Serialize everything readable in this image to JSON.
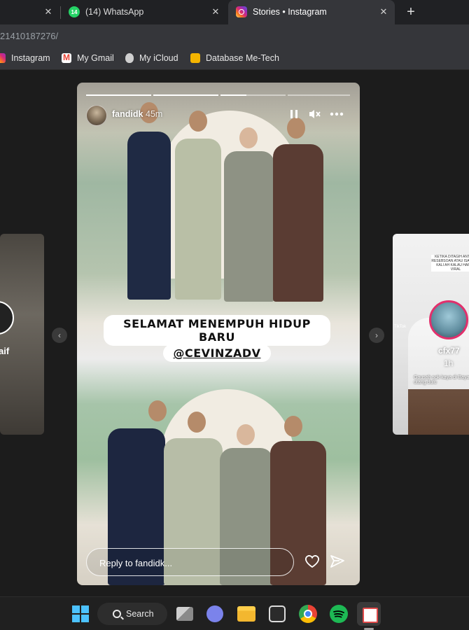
{
  "browser": {
    "tabs": [
      {
        "label": ""
      },
      {
        "label": "(14) WhatsApp",
        "badge": "14"
      },
      {
        "label": "Stories • Instagram"
      }
    ],
    "new_tab_label": "+",
    "close_label": "✕",
    "url": "21410187276/",
    "bookmarks": [
      {
        "label": "Instagram"
      },
      {
        "label": "My Gmail"
      },
      {
        "label": "My iCloud"
      },
      {
        "label": "Database Me-Tech"
      }
    ]
  },
  "stories": {
    "left_preview": {
      "name": "aif"
    },
    "right_preview": {
      "name": "cfx77",
      "time": "1h",
      "overlay_text": "Gausah sok kaya di Bayar utang dulu",
      "caption": "KETIKA DITAGIH ANTARA RESEBSOAN ATAU ISA MALU KALI AH KALAU HARUS VIRAL",
      "watermark": "TikTok"
    },
    "active": {
      "username": "fandidk",
      "time": "45m",
      "progress": [
        1.0,
        1.0,
        0.4,
        0.0
      ],
      "caption_line1": "SELAMAT MENEMPUH HIDUP BARU",
      "caption_line2": "@CEVINZADV",
      "reply_placeholder": "Reply to fandidk..."
    },
    "nav_prev": "‹",
    "nav_next": "›"
  },
  "taskbar": {
    "search_label": "Search"
  },
  "icons": {
    "pause": "pause-icon",
    "mute": "mute-icon",
    "more": "more-icon",
    "heart": "heart-icon",
    "send": "send-icon"
  }
}
